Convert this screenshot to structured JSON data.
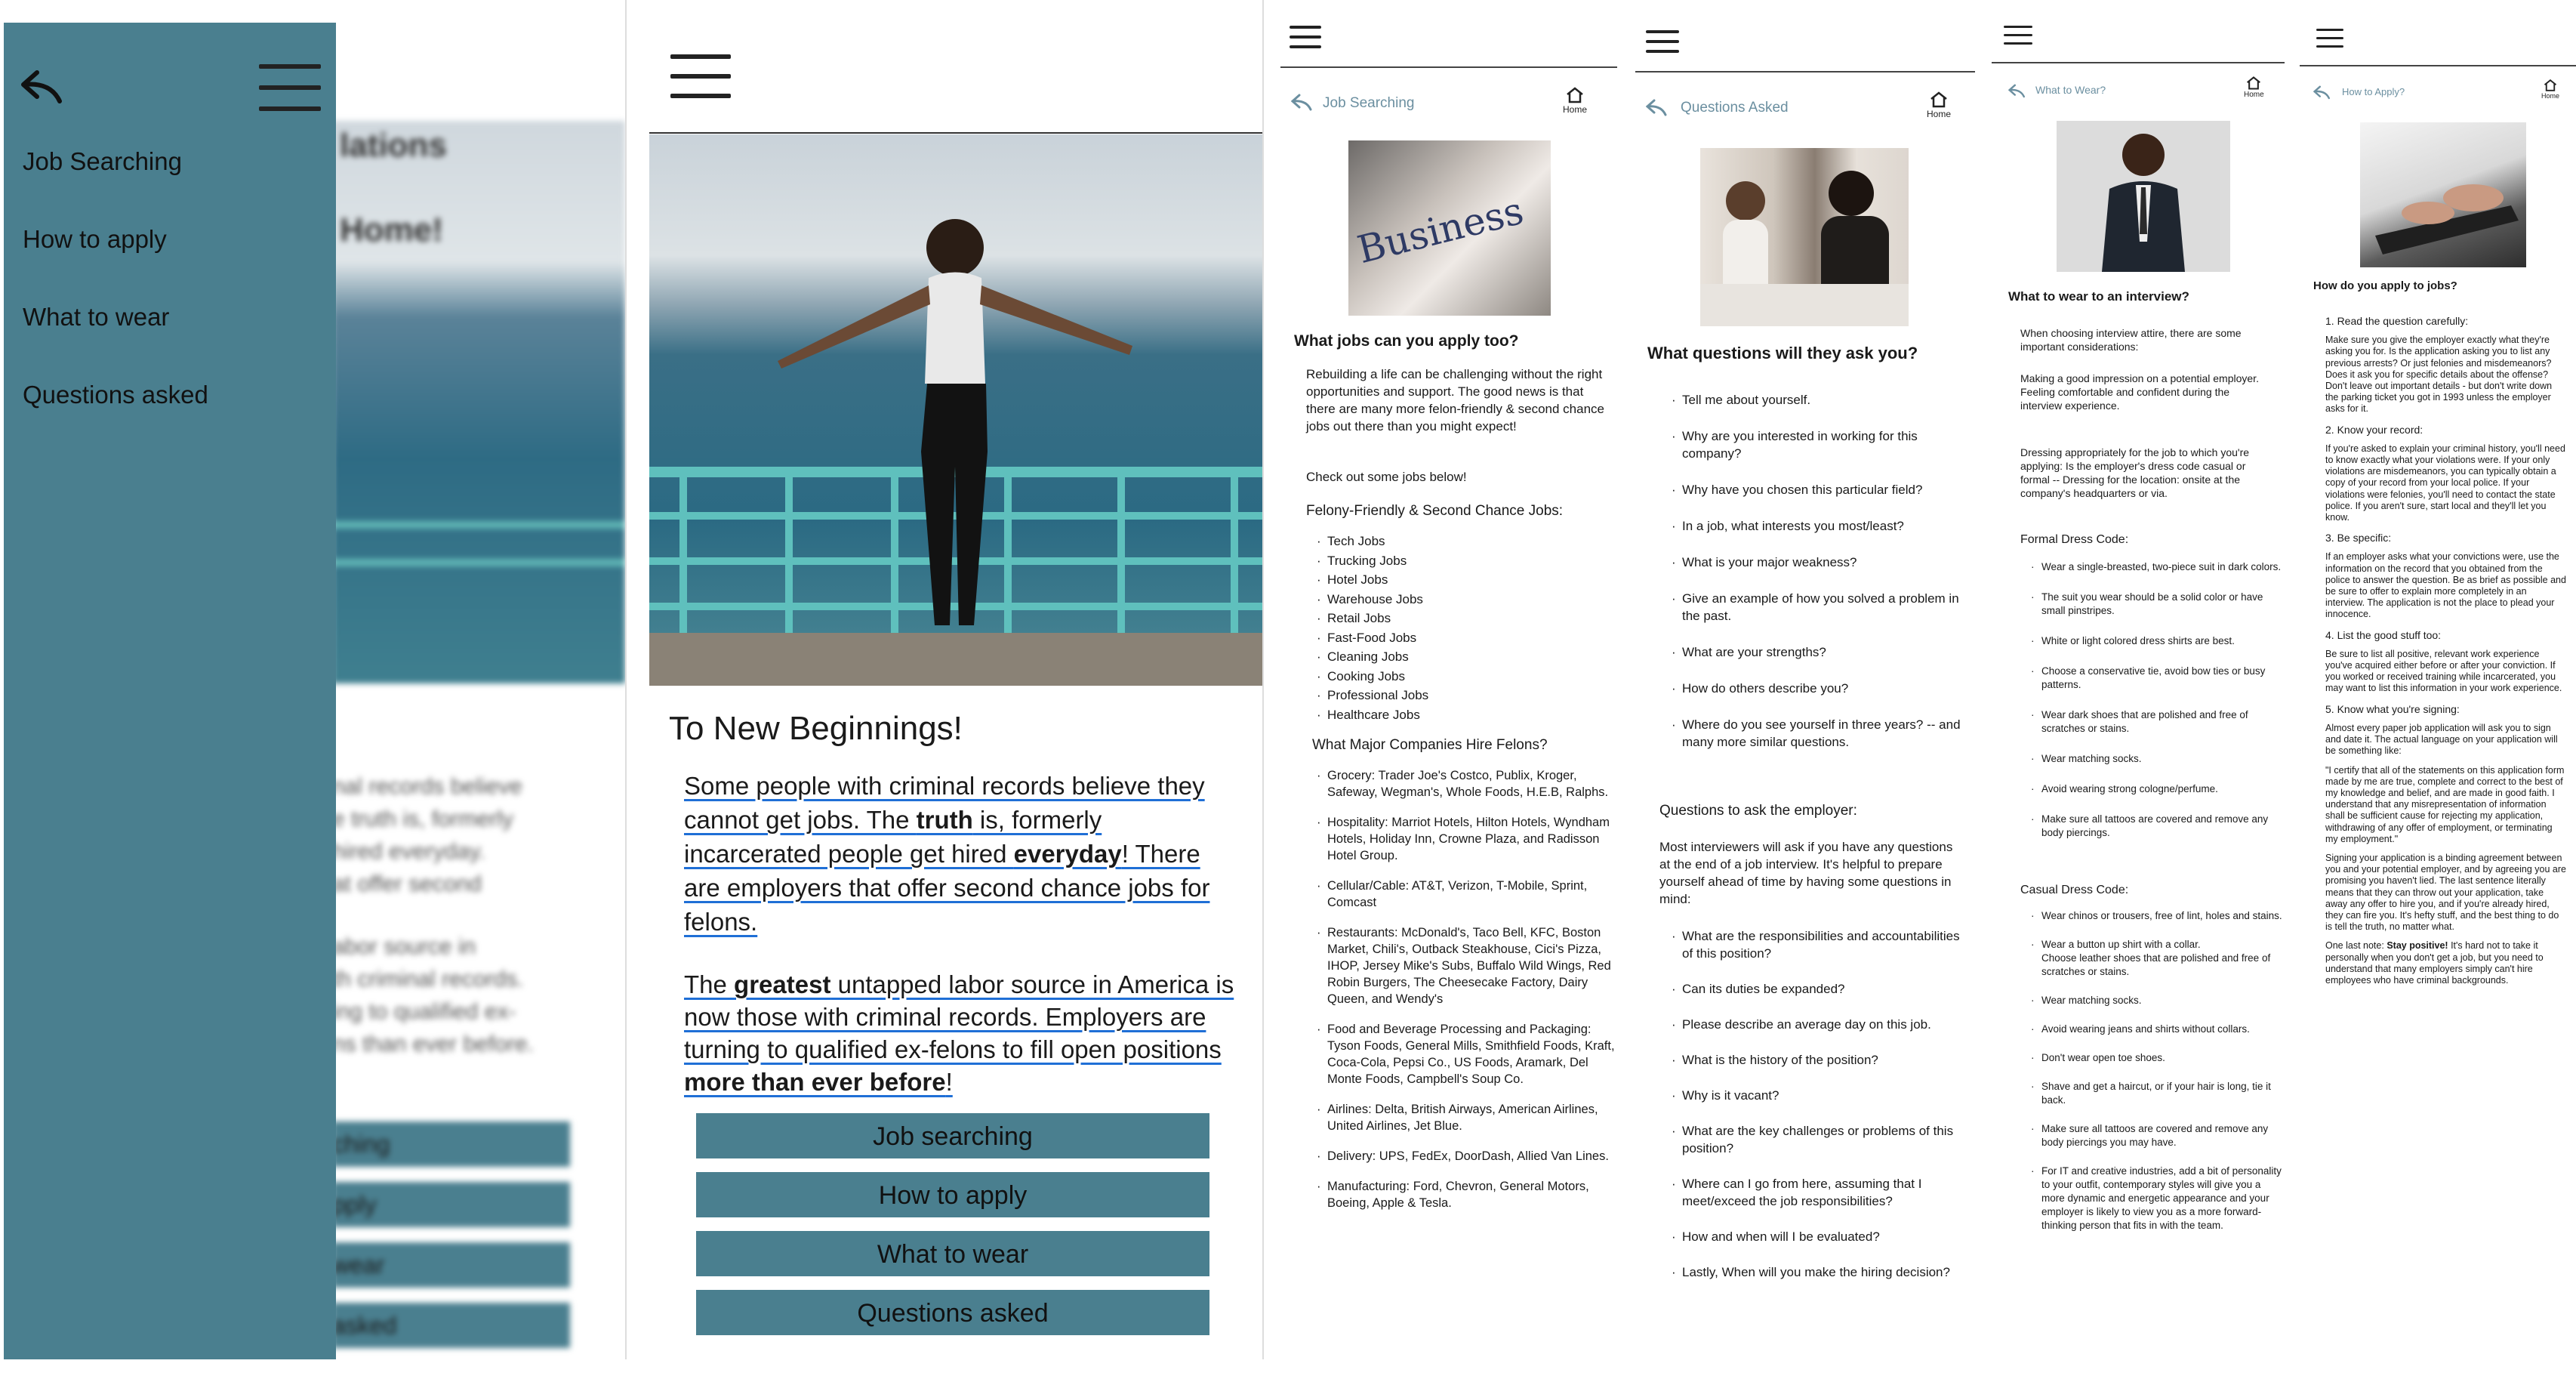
{
  "colors": {
    "teal": "#4a7f8f",
    "link_underline": "#1f6fd6",
    "back_icon": "#6b8fa0"
  },
  "screen1": {
    "menu": [
      "Job Searching",
      "How to apply",
      "What to wear",
      "Questions asked"
    ],
    "blur_title_1": "lations",
    "blur_title_2": "Home!",
    "blur_lines": [
      "nal records believe",
      "e truth is, formerly",
      "hired everyday.",
      "at offer second",
      "abor source in",
      "th criminal records.",
      "ing to qualified ex-",
      "ns than ever before."
    ],
    "blur_buttons": [
      "ching",
      "pply",
      "wear",
      "asked"
    ]
  },
  "screen2": {
    "heading": "To New Beginnings!",
    "p1": {
      "a": "Some people with criminal records believe they cannot get jobs. The ",
      "b": "truth",
      "c": " is, formerly incarcerated people get hired ",
      "d": "everyday",
      "e": "! There are employers that offer second chance jobs for felons."
    },
    "p2": {
      "a": "The ",
      "b": "greatest",
      "c": " untapped labor source in America is now those with criminal records. Employers are turning to qualified ex-felons to fill open positions ",
      "d": "more than ever before",
      "e": "!"
    },
    "buttons": [
      "Job searching",
      "How to apply",
      "What to wear",
      "Questions asked"
    ]
  },
  "screen3": {
    "nav_title": "Job Searching",
    "home_label": "Home",
    "photo_word": "Business",
    "h1": "What jobs can you apply too?",
    "intro": "Rebuilding a life can be challenging without the right opportunities and support. The good news is that there are many more felon-friendly & second chance jobs out there than you might expect!",
    "check": "Check out some jobs below!",
    "h2": "Felony-Friendly & Second Chance Jobs:",
    "jobs": [
      "Tech Jobs",
      "Trucking Jobs",
      "Hotel Jobs",
      "Warehouse Jobs",
      "Retail Jobs",
      "Fast-Food Jobs",
      "Cleaning Jobs",
      "Cooking Jobs",
      "Professional Jobs",
      "Healthcare Jobs"
    ],
    "h3": "What Major Companies Hire Felons?",
    "companies": [
      "Grocery: Trader Joe's Costco, Publix, Kroger, Safeway, Wegman's, Whole Foods, H.E.B, Ralphs.",
      "Hospitality: Marriot Hotels, Hilton Hotels, Wyndham Hotels, Holiday Inn, Crowne Plaza, and Radisson Hotel Group.",
      "Cellular/Cable: AT&T, Verizon, T-Mobile, Sprint, Comcast",
      "Restaurants: McDonald's, Taco Bell, KFC, Boston Market, Chili's, Outback Steakhouse, Cici's Pizza, IHOP, Jersey Mike's Subs, Buffalo Wild Wings, Red Robin Burgers, The Cheesecake Factory, Dairy Queen, and Wendy's",
      "Food and Beverage Processing and Packaging: Tyson Foods, General Mills, Smithfield Foods, Kraft, Coca-Cola, Pepsi Co., US Foods, Aramark, Del Monte Foods, Campbell's Soup Co.",
      "Airlines: Delta, British Airways, American Airlines, United Airlines, Jet Blue.",
      "Delivery: UPS, FedEx, DoorDash, Allied Van Lines.",
      "Manufacturing: Ford, Chevron, General Motors, Boeing, Apple & Tesla."
    ]
  },
  "screen4": {
    "nav_title": "Questions Asked",
    "home_label": "Home",
    "h1": "What questions will they ask you?",
    "questions": [
      "Tell me about yourself.",
      "Why are you interested in working for this company?",
      "Why have you chosen this particular field?",
      "In a job, what interests you most/least?",
      "What is your major weakness?",
      "Give an example of how you solved a problem in the past.",
      "What are your strengths?",
      "How do others describe you?",
      "Where do you see yourself in three years? -- and many more similar questions."
    ],
    "h2": "Questions to ask the employer:",
    "intro": "Most interviewers will ask if you have any questions at the end of a job interview. It's helpful to prepare yourself ahead of time by having some questions in mind:",
    "ask": [
      "What are the responsibilities and accountabilities of this position?",
      "Can its duties be expanded?",
      "Please describe an average day on this job.",
      "What is the history of the position?",
      "Why is it vacant?",
      "What are the key challenges or problems of this position?",
      "Where can I go from here, assuming that I meet/exceed the job responsibilities?",
      "How and when will I be evaluated?",
      "Lastly, When will you make the hiring decision?"
    ]
  },
  "screen5": {
    "nav_title": "What to Wear?",
    "home_label": "Home",
    "h1": "What to wear to an interview?",
    "p1": "When choosing interview attire, there are some important considerations:",
    "p2": "Making a good impression on a potential employer.\nFeeling comfortable and confident during the interview experience.",
    "p3": "Dressing appropriately for the job to which you're applying: Is the employer's dress code casual or formal -- Dressing for the location: onsite at the company's headquarters or via.",
    "h2": "Formal Dress Code:",
    "formal": [
      "Wear a single-breasted, two-piece suit in dark colors.",
      "The suit you wear should be a solid color or have small pinstripes.",
      "White or light colored dress shirts are best.",
      "Choose a conservative tie, avoid bow ties or busy patterns.",
      "Wear dark shoes that are polished and free of scratches or stains.",
      "Wear matching socks.",
      "Avoid wearing strong cologne/perfume.",
      "Make sure all tattoos are covered and remove any body piercings."
    ],
    "h3": "Casual Dress Code:",
    "casual": [
      "Wear chinos or trousers, free of lint, holes and stains.",
      "Wear a button up shirt with a collar.\nChoose leather shoes that are polished and free of scratches or stains.",
      "Wear matching socks.",
      "Avoid wearing jeans and shirts without collars.",
      "Don't wear open toe shoes.",
      "Shave and get a haircut, or if your hair is long, tie it back.",
      "Make sure all tattoos are covered and remove any body piercings you may have.",
      "For IT and creative industries, add a bit of personality to your outfit, contemporary styles will give you a more dynamic and energetic appearance and your employer is likely to view you as a more forward-thinking person that fits in with the team."
    ]
  },
  "screen6": {
    "nav_title": "How to Apply?",
    "home_label": "Home",
    "h1": "How do you apply to jobs?",
    "sections": [
      {
        "title": "1. Read the question carefully:",
        "body": "Make sure you give the employer exactly what they're asking you for. Is the application asking you to list any previous arrests? Or just felonies and misdemeanors? Does it ask you for specific details about the offense? Don't leave out important details - but don't write down the parking ticket you got in 1993 unless the employer asks for it."
      },
      {
        "title": "2. Know your record:",
        "body": "If you're asked to explain your criminal history, you'll need to know exactly what your violations were. If your only violations are misdemeanors, you can typically obtain a copy of your record from your local police. If your violations were felonies, you'll need to contact the state police. If you aren't sure, start local and they'll let you know."
      },
      {
        "title": "3. Be specific:",
        "body": "If an employer asks what your convictions were, use the information on the record that you obtained from the police to answer the question. Be as brief as possible and be sure to offer to explain more completely in an interview. The application is not the place to plead your innocence."
      },
      {
        "title": "4. List the good stuff too:",
        "body": "Be sure to list all positive, relevant work experience you've acquired either before or after your conviction. If you worked or received training while incarcerated, you may want to list this information in your work experience."
      },
      {
        "title": "5. Know what you're signing:",
        "body": "Almost every paper job application will ask you to sign and date it. The actual language on your application will be something like:"
      }
    ],
    "quote": "\"I certify that all of the statements on this application form made by me are true, complete and correct to the best of my knowledge and belief, and are made in good faith. I understand that any misrepresentation of information shall be sufficient cause for rejecting my application, withdrawing of any offer of employment, or terminating my employment.\"",
    "signing": "Signing your application is a binding agreement between you and your potential employer, and by agreeing you are promising you haven't lied. The last sentence literally means that they can throw out your application, take away any offer to hire you, and if you're already hired, they can fire you. It's hefty stuff, and the best thing to do is tell the truth, no matter what.",
    "last_a": "One last note: ",
    "last_b": "Stay positive!",
    "last_c": " It's hard not to take it personally when you don't get a job, but you need to understand that many employers simply can't hire employees who have criminal backgrounds."
  }
}
